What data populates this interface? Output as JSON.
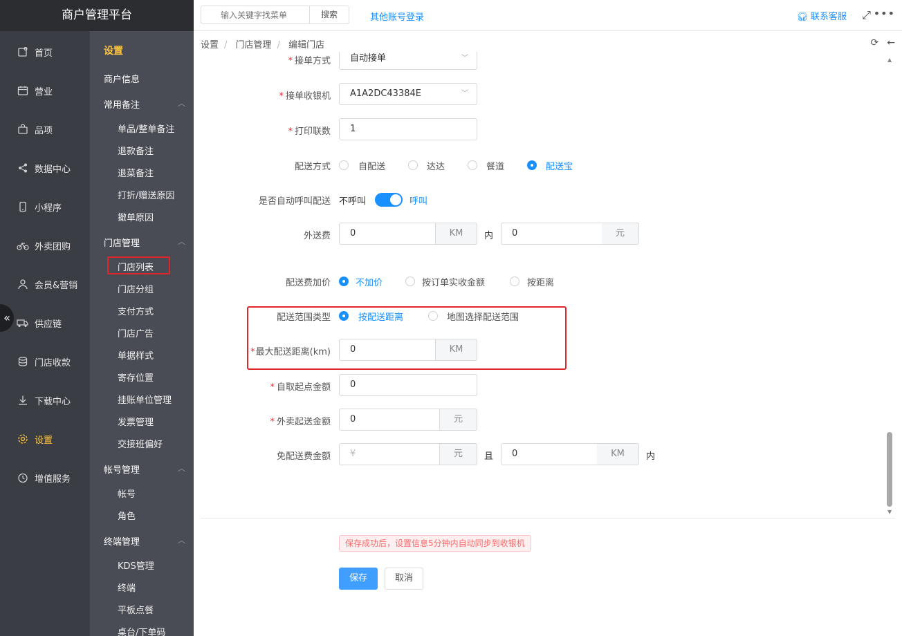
{
  "app": {
    "title": "商户管理平台"
  },
  "nav": {
    "items": [
      {
        "label": "首页",
        "icon": "home-icon"
      },
      {
        "label": "营业",
        "icon": "calendar-icon"
      },
      {
        "label": "品项",
        "icon": "bag-icon"
      },
      {
        "label": "数据中心",
        "icon": "share-icon"
      },
      {
        "label": "小程序",
        "icon": "phone-icon"
      },
      {
        "label": "外卖团购",
        "icon": "bike-icon"
      },
      {
        "label": "会员&营销",
        "icon": "user-icon"
      },
      {
        "label": "供应链",
        "icon": "truck-icon"
      },
      {
        "label": "门店收款",
        "icon": "coins-icon"
      },
      {
        "label": "下载中心",
        "icon": "download-icon"
      },
      {
        "label": "设置",
        "icon": "gear-icon"
      },
      {
        "label": "增值服务",
        "icon": "clock-icon"
      }
    ],
    "active": "设置"
  },
  "submenu": {
    "title": "设置",
    "merchant_info": "商户信息",
    "groups": [
      {
        "label": "常用备注",
        "items": [
          "单品/整单备注",
          "退款备注",
          "退菜备注",
          "打折/赠送原因",
          "撤单原因"
        ]
      },
      {
        "label": "门店管理",
        "items": [
          "门店列表",
          "门店分组",
          "支付方式",
          "门店广告",
          "单据样式",
          "寄存位置",
          "挂账单位管理",
          "发票管理",
          "交接班偏好"
        ]
      },
      {
        "label": "帐号管理",
        "items": [
          "帐号",
          "角色"
        ]
      },
      {
        "label": "终端管理",
        "items": [
          "KDS管理",
          "终端",
          "平板点餐",
          "桌台/下单码"
        ]
      }
    ],
    "selected": "门店列表"
  },
  "topbar": {
    "search_placeholder": "输入关键字找菜单",
    "search_button": "搜索",
    "other_login": "其他账号登录",
    "service": "联系客服"
  },
  "breadcrumb": [
    "设置",
    "门店管理",
    "编辑门店"
  ],
  "form": {
    "accept_mode": {
      "label": "接单方式",
      "value": "自动接单"
    },
    "accept_cashier": {
      "label": "接单收银机",
      "value": "A1A2DC43384E"
    },
    "print_copies": {
      "label": "打印联数",
      "value": "1"
    },
    "delivery_method": {
      "label": "配送方式",
      "options": [
        "自配送",
        "达达",
        "餐道",
        "配送宝"
      ],
      "selected": "配送宝"
    },
    "auto_call": {
      "label": "是否自动呼叫配送",
      "off_text": "不呼叫",
      "on_text": "呼叫",
      "on": true
    },
    "delivery_fee": {
      "label": "外送费",
      "km_value": "0",
      "km_unit": "KM",
      "within": "内",
      "fee_value": "0",
      "fee_unit": "元"
    },
    "fee_markup": {
      "label": "配送费加价",
      "options": [
        "不加价",
        "按订单实收金额",
        "按距离"
      ],
      "selected": "不加价"
    },
    "range_type": {
      "label": "配送范围类型",
      "options": [
        "按配送距离",
        "地图选择配送范围"
      ],
      "selected": "按配送距离"
    },
    "max_distance": {
      "label": "最大配送距离(km)",
      "value": "0",
      "unit": "KM"
    },
    "pickup_min": {
      "label": "自取起点金额",
      "value": "0"
    },
    "delivery_min": {
      "label": "外卖起送金额",
      "value": "0",
      "unit": "元"
    },
    "free_fee": {
      "label": "免配送费金额",
      "placeholder": "¥",
      "unit": "元",
      "and": "且",
      "km_value": "0",
      "km_unit": "KM",
      "within": "内"
    }
  },
  "footer": {
    "notice": "保存成功后，设置信息5分钟内自动同步到收银机",
    "save": "保存",
    "cancel": "取消"
  }
}
